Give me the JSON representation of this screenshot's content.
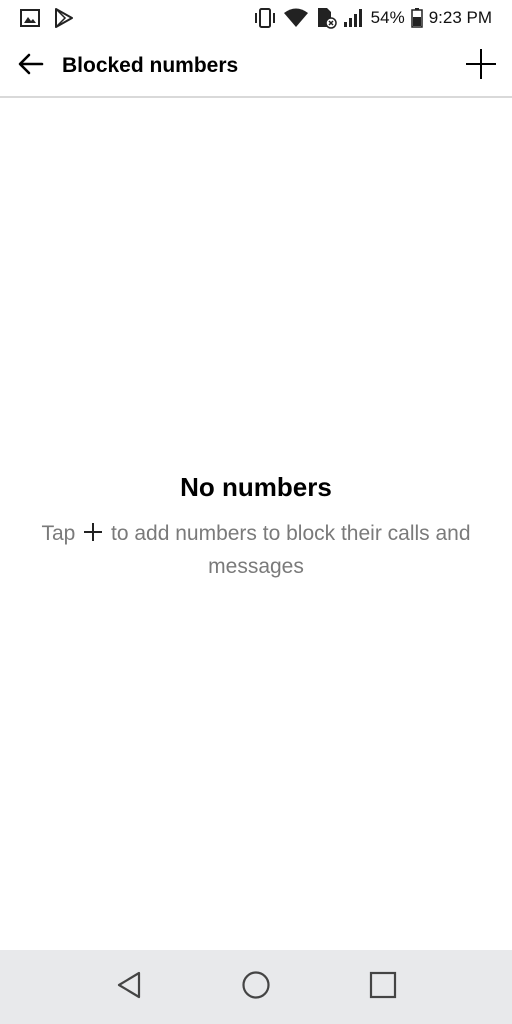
{
  "status_bar": {
    "left_icons": [
      "image-icon",
      "play-store-icon"
    ],
    "right_icons": [
      "vibrate-icon",
      "wifi-icon",
      "sim-icon",
      "signal-icon",
      "battery-icon"
    ],
    "battery_percent": "54%",
    "time": "9:23 PM"
  },
  "app_bar": {
    "back_icon": "arrow-back-icon",
    "title": "Blocked numbers",
    "add_icon": "plus-icon"
  },
  "empty_state": {
    "title": "No numbers",
    "description_before_icon": "Tap",
    "description_after_icon": "to add numbers to block their calls and messages",
    "inline_icon": "plus-icon"
  },
  "nav_bar": {
    "buttons": [
      "back-triangle-icon",
      "home-circle-icon",
      "recents-square-icon"
    ]
  },
  "colors": {
    "background": "#ffffff",
    "divider": "#d9d9d9",
    "secondary_text": "#7a7a7a",
    "nav_bar_bg": "#e8e9eb"
  }
}
